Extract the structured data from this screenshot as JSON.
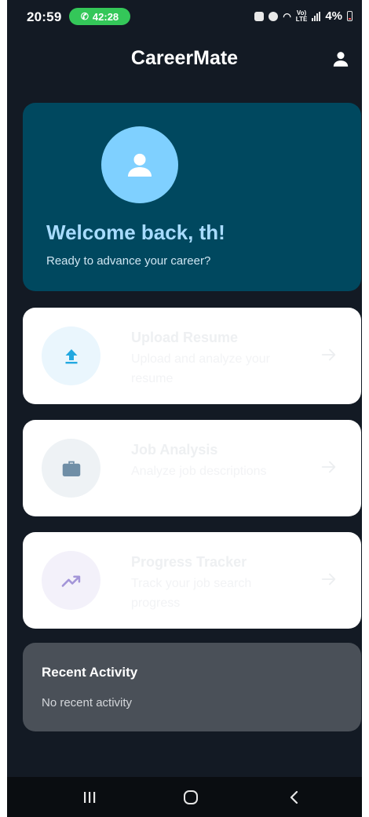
{
  "status_bar": {
    "time": "20:59",
    "call_timer": "42:28",
    "network_label": "Vo)",
    "network_sub": "LTE",
    "battery": "4%"
  },
  "app_bar": {
    "title": "CareerMate"
  },
  "welcome": {
    "title": "Welcome back, th!",
    "subtitle": "Ready to advance your career?"
  },
  "actions": [
    {
      "title": "Upload Resume",
      "description": "Upload and analyze your resume",
      "icon": "upload-icon",
      "icon_color": "#22a8e0",
      "icon_bg": "#eaf6fd"
    },
    {
      "title": "Job Analysis",
      "description": "Analyze job descriptions",
      "icon": "briefcase-icon",
      "icon_color": "#6f8ea6",
      "icon_bg": "#eef2f5"
    },
    {
      "title": "Progress Tracker",
      "description": "Track your job search progress",
      "icon": "trending-up-icon",
      "icon_color": "#a395d8",
      "icon_bg": "#f3f1fa"
    }
  ],
  "recent_activity": {
    "title": "Recent Activity",
    "empty_text": "No recent activity"
  },
  "colors": {
    "background": "#131a24",
    "welcome_card": "#00485f",
    "avatar": "#7fd0ff",
    "recent_card": "#4a5058"
  }
}
